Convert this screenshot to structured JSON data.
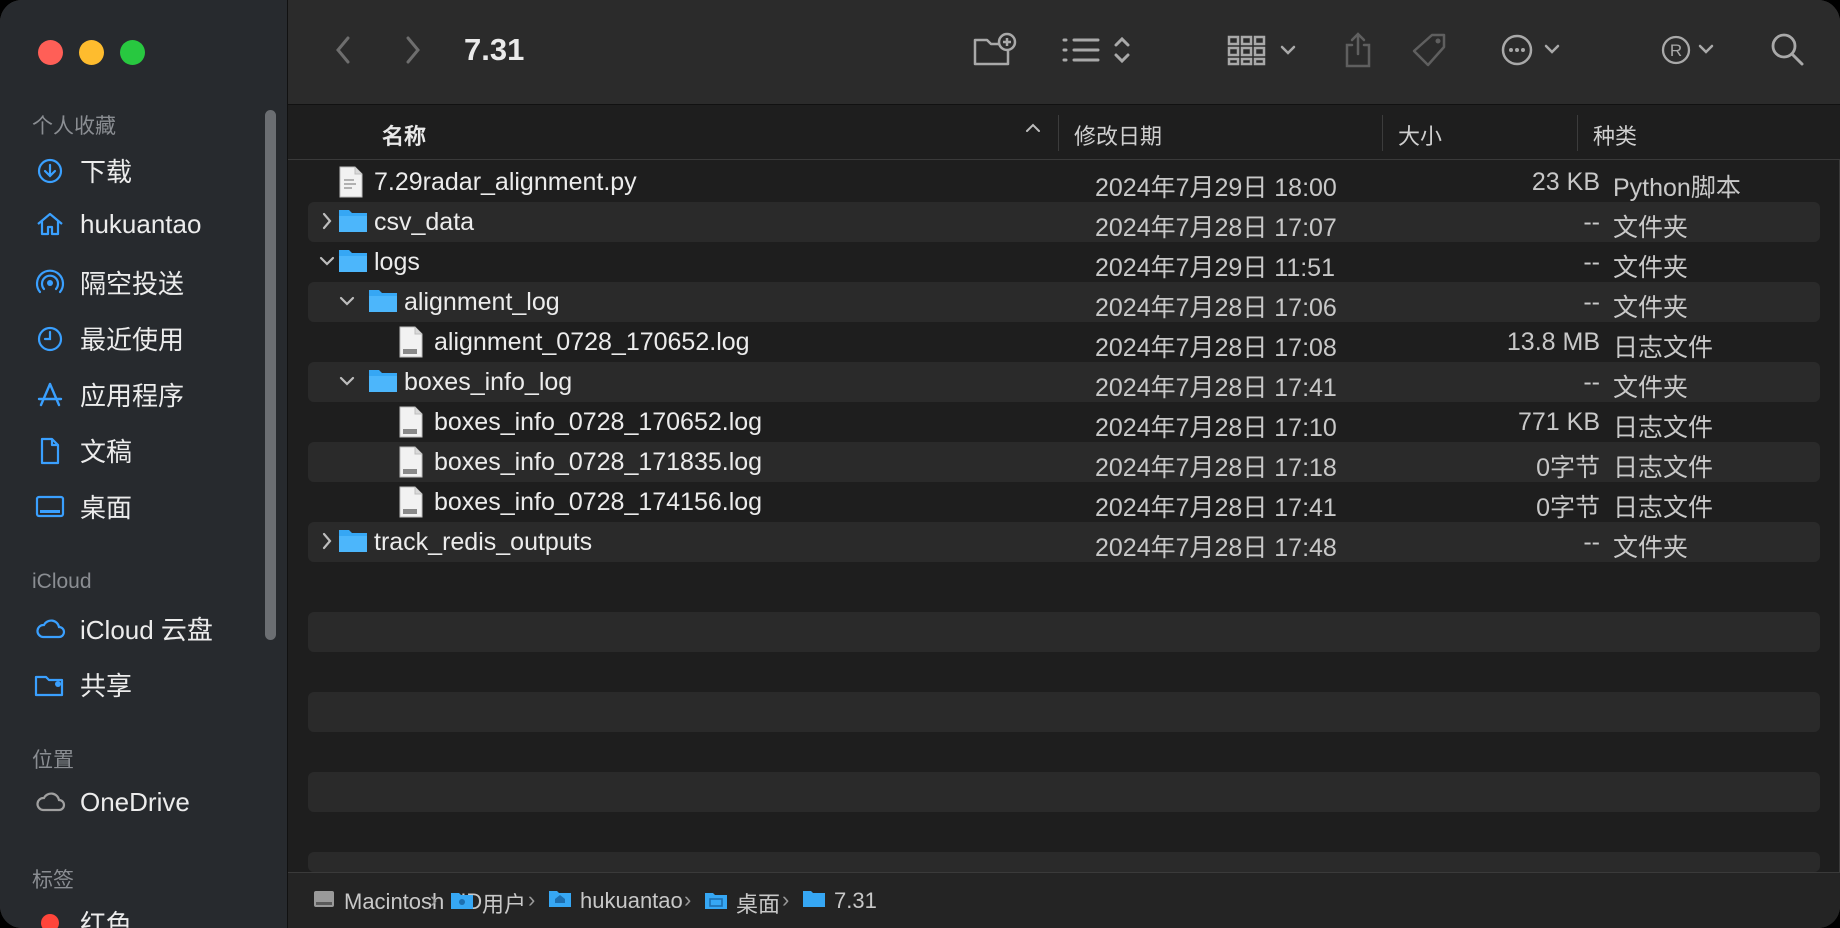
{
  "window": {
    "title": "7.31"
  },
  "sidebar": {
    "favorites_header": "个人收藏",
    "favorites": [
      {
        "label": "下载",
        "icon": "download-icon"
      },
      {
        "label": "hukuantao",
        "icon": "home-icon"
      },
      {
        "label": "隔空投送",
        "icon": "airdrop-icon"
      },
      {
        "label": "最近使用",
        "icon": "clock-icon"
      },
      {
        "label": "应用程序",
        "icon": "applications-icon"
      },
      {
        "label": "文稿",
        "icon": "document-icon"
      },
      {
        "label": "桌面",
        "icon": "desktop-icon"
      }
    ],
    "icloud_header": "iCloud",
    "icloud": [
      {
        "label": "iCloud 云盘",
        "icon": "cloud-icon"
      },
      {
        "label": "共享",
        "icon": "shared-folder-icon"
      }
    ],
    "locations_header": "位置",
    "locations": [
      {
        "label": "OneDrive",
        "icon": "cloud-outline-icon"
      }
    ],
    "tags_header": "标签",
    "tags": [
      {
        "label": "红色",
        "color": "#ff453a"
      }
    ]
  },
  "columns": {
    "name": "名称",
    "date": "修改日期",
    "size": "大小",
    "kind": "种类"
  },
  "files": [
    {
      "name": "7.29radar_alignment.py",
      "date": "2024年7月29日 18:00",
      "size": "23 KB",
      "kind": "Python脚本",
      "type": "file-py",
      "level": 0,
      "disclosure": ""
    },
    {
      "name": "csv_data",
      "date": "2024年7月28日 17:07",
      "size": "--",
      "kind": "文件夹",
      "type": "folder",
      "level": 0,
      "disclosure": "collapsed"
    },
    {
      "name": "logs",
      "date": "2024年7月29日 11:51",
      "size": "--",
      "kind": "文件夹",
      "type": "folder",
      "level": 0,
      "disclosure": "expanded"
    },
    {
      "name": "alignment_log",
      "date": "2024年7月28日 17:06",
      "size": "--",
      "kind": "文件夹",
      "type": "folder",
      "level": 1,
      "disclosure": "expanded"
    },
    {
      "name": "alignment_0728_170652.log",
      "date": "2024年7月28日 17:08",
      "size": "13.8 MB",
      "kind": "日志文件",
      "type": "file-log",
      "level": 2,
      "disclosure": ""
    },
    {
      "name": "boxes_info_log",
      "date": "2024年7月28日 17:41",
      "size": "--",
      "kind": "文件夹",
      "type": "folder",
      "level": 1,
      "disclosure": "expanded"
    },
    {
      "name": "boxes_info_0728_170652.log",
      "date": "2024年7月28日 17:10",
      "size": "771 KB",
      "kind": "日志文件",
      "type": "file-log",
      "level": 2,
      "disclosure": ""
    },
    {
      "name": "boxes_info_0728_171835.log",
      "date": "2024年7月28日 17:18",
      "size": "0字节",
      "kind": "日志文件",
      "type": "file-log",
      "level": 2,
      "disclosure": ""
    },
    {
      "name": "boxes_info_0728_174156.log",
      "date": "2024年7月28日 17:41",
      "size": "0字节",
      "kind": "日志文件",
      "type": "file-log",
      "level": 2,
      "disclosure": ""
    },
    {
      "name": "track_redis_outputs",
      "date": "2024年7月28日 17:48",
      "size": "--",
      "kind": "文件夹",
      "type": "folder",
      "level": 0,
      "disclosure": "collapsed"
    }
  ],
  "pathbar": [
    {
      "label": "Macintosh HD",
      "icon": "hard-drive-icon"
    },
    {
      "label": "用户",
      "icon": "folder-icon"
    },
    {
      "label": "hukuantao",
      "icon": "home-folder-icon"
    },
    {
      "label": "桌面",
      "icon": "desktop-folder-icon"
    },
    {
      "label": "7.31",
      "icon": "folder-icon"
    }
  ],
  "colors": {
    "accent": "#3aa0ff",
    "folder": "#36a7f4"
  }
}
